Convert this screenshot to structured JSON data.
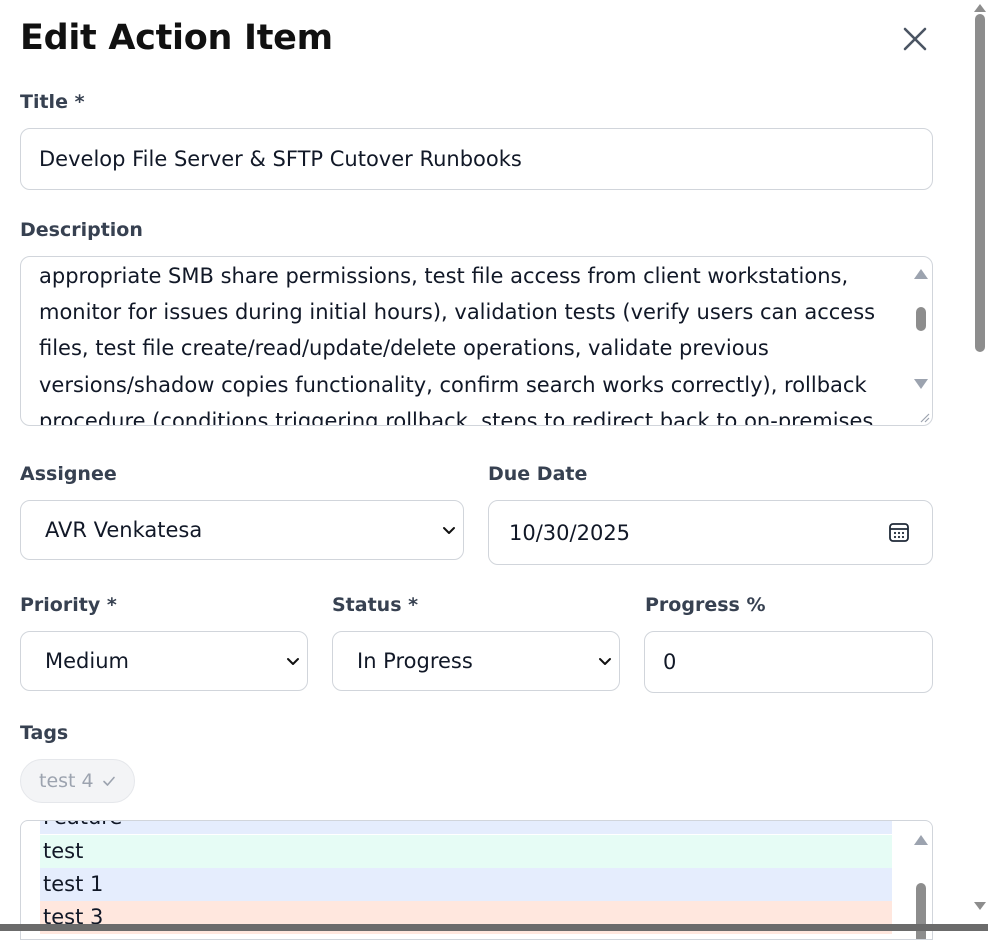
{
  "dialog": {
    "title": "Edit Action Item"
  },
  "form": {
    "title_label": "Title *",
    "title_value": "Develop File Server & SFTP Cutover Runbooks",
    "description_label": "Description",
    "description_value": "appropriate SMB share permissions, test file access from client workstations, monitor for issues during initial hours), validation tests (verify users can access files, test file create/read/update/delete operations, validate previous versions/shadow copies functionality, confirm search works correctly), rollback procedure (conditions triggering rollback, steps to redirect back to on-premises",
    "assignee_label": "Assignee",
    "assignee_value": "AVR Venkatesa",
    "due_date_label": "Due Date",
    "due_date_value": "10/30/2025",
    "priority_label": "Priority *",
    "priority_value": "Medium",
    "status_label": "Status *",
    "status_value": "In Progress",
    "progress_label": "Progress %",
    "progress_value": "0",
    "tags_label": "Tags"
  },
  "tags": {
    "selected": [
      "test 4"
    ],
    "options": [
      {
        "label": "Feature",
        "color": "#e5edfd"
      },
      {
        "label": "test",
        "color": "#e6fcf5"
      },
      {
        "label": "test 1",
        "color": "#e5edfd"
      },
      {
        "label": "test 3",
        "color": "#ffe7de"
      }
    ]
  },
  "icons": {
    "close": "close-icon",
    "calendar": "calendar-icon",
    "chevron": "chevron-down-icon",
    "check": "check-icon"
  },
  "colors": {
    "border": "#d1d5db",
    "label": "#374151",
    "text": "#111827"
  }
}
